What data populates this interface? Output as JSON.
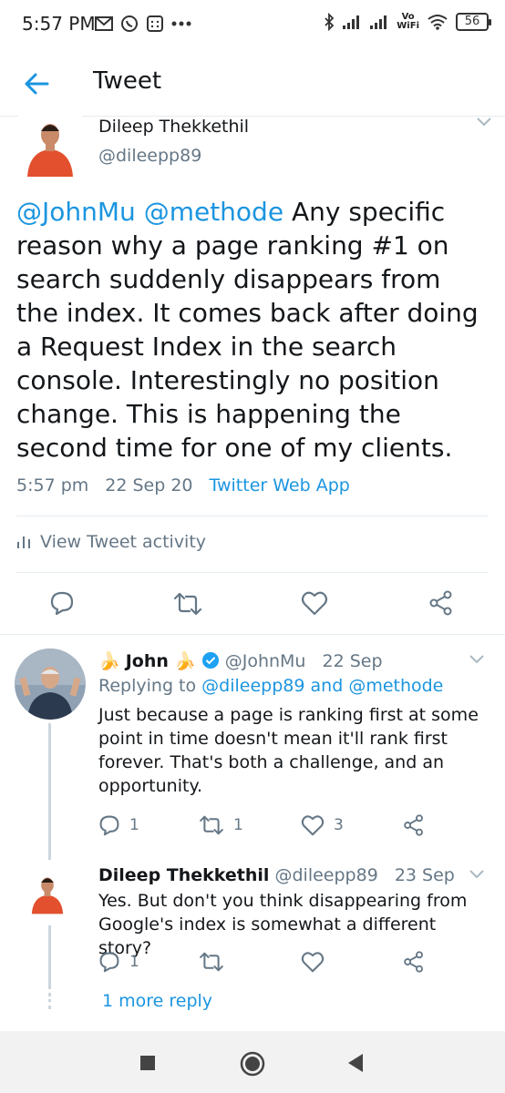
{
  "status_bar": {
    "time": "5:57 PM",
    "vo_top": "Vo",
    "vo_bottom": "WiFi",
    "battery": "56"
  },
  "header": {
    "title": "Tweet"
  },
  "main_tweet": {
    "name": "Dileep Thekkethil",
    "handle": "@dileepp89",
    "mention1": "@JohnMu",
    "mention2": "@methode",
    "text": " Any specific reason why a page ranking #1 on search suddenly disappears from the index. It comes back after doing a Request Index in the search console. Interestingly no position change. This is happening the second time for one of my clients.",
    "time": "5:57 pm",
    "date": "22 Sep 20",
    "app": "Twitter Web App",
    "activity": "View Tweet activity"
  },
  "reply1": {
    "name": "John",
    "handle": "@JohnMu",
    "date": "22 Sep",
    "replying_prefix": "Replying to",
    "replying_mention1": "@dileepp89",
    "replying_and": "and",
    "replying_mention2": "@methode",
    "text": "Just because a page is ranking first at some point in time doesn't mean it'll rank first forever. That's both a challenge, and an opportunity.",
    "reply_count": "1",
    "retweet_count": "1",
    "like_count": "3"
  },
  "reply2": {
    "name": "Dileep Thekkethil",
    "handle": "@dileepp89",
    "date": "23 Sep",
    "text": "Yes. But don't you think disappearing from Google's index is somewhat a different story?",
    "reply_count": "1"
  },
  "more_reply": "1 more reply",
  "colors": {
    "accent": "#1b95e0",
    "secondary_text": "#657786",
    "divider": "#e6ecf0",
    "verified": "#1da1f2"
  }
}
